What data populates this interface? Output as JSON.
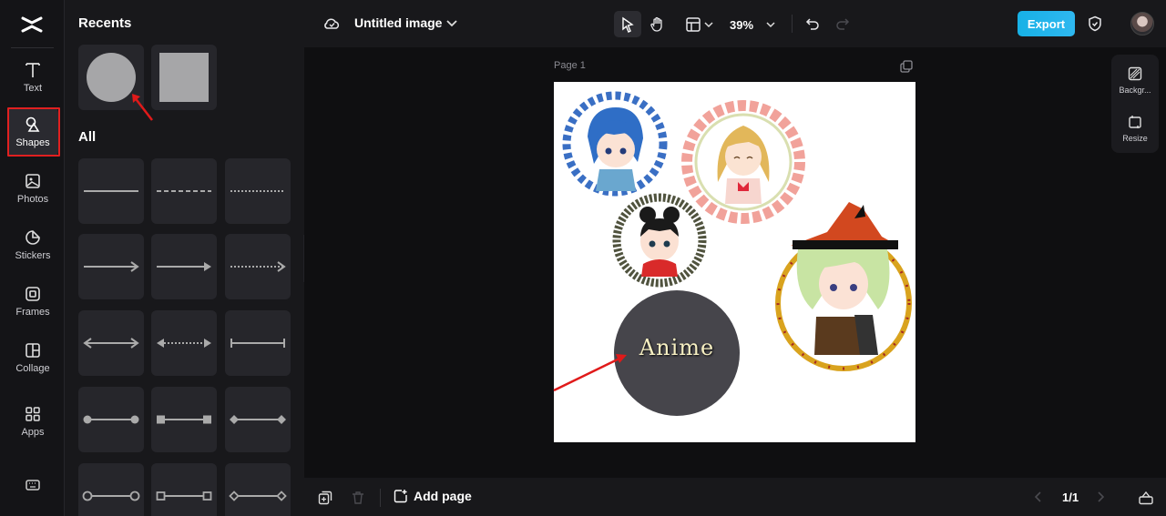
{
  "rail": {
    "items": [
      {
        "label": "Text"
      },
      {
        "label": "Shapes"
      },
      {
        "label": "Photos"
      },
      {
        "label": "Stickers"
      },
      {
        "label": "Frames"
      },
      {
        "label": "Collage"
      },
      {
        "label": "Apps"
      }
    ],
    "active": "Shapes"
  },
  "panel": {
    "recents_title": "Recents",
    "all_title": "All"
  },
  "topbar": {
    "title": "Untitled image",
    "zoom": "39%",
    "export_label": "Export"
  },
  "canvas": {
    "page_label": "Page 1",
    "circle_text": "Anime",
    "circle_color": "#46454b"
  },
  "right_tools": {
    "background_label": "Backgr...",
    "resize_label": "Resize"
  },
  "bottombar": {
    "add_page_label": "Add page",
    "pager": "1/1"
  },
  "colors": {
    "accent": "#1fb2ea",
    "highlight": "#e02020",
    "shape_gray": "#a6a6a8"
  }
}
